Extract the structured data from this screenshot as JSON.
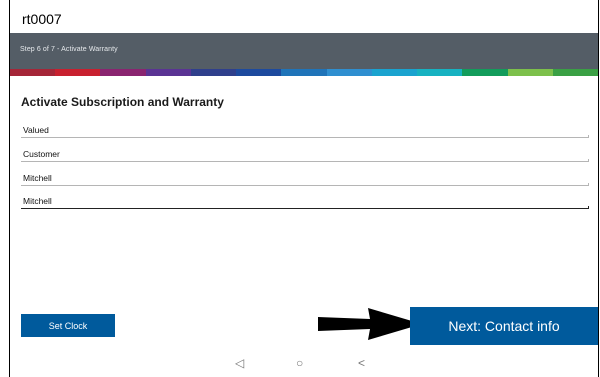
{
  "window": {
    "title": "rt0007"
  },
  "step": {
    "label": "Step 6 of 7 - Activate Warranty"
  },
  "progress_colors": [
    "#a52638",
    "#c8202f",
    "#8a2470",
    "#5a3394",
    "#2f3f8c",
    "#1d4a9e",
    "#1f74b9",
    "#2f8fd0",
    "#1aa3cf",
    "#17b2c1",
    "#129c5b",
    "#7dc04b",
    "#3aa044"
  ],
  "form": {
    "heading": "Activate Subscription and Warranty",
    "fields": [
      {
        "value": "Valued"
      },
      {
        "value": "Customer"
      },
      {
        "value": "Mitchell"
      },
      {
        "value": "Mitchell"
      }
    ]
  },
  "buttons": {
    "set_clock": "Set Clock",
    "next": "Next: Contact info"
  },
  "navbar": {
    "back": "◁",
    "home": "○",
    "recent": "<"
  }
}
